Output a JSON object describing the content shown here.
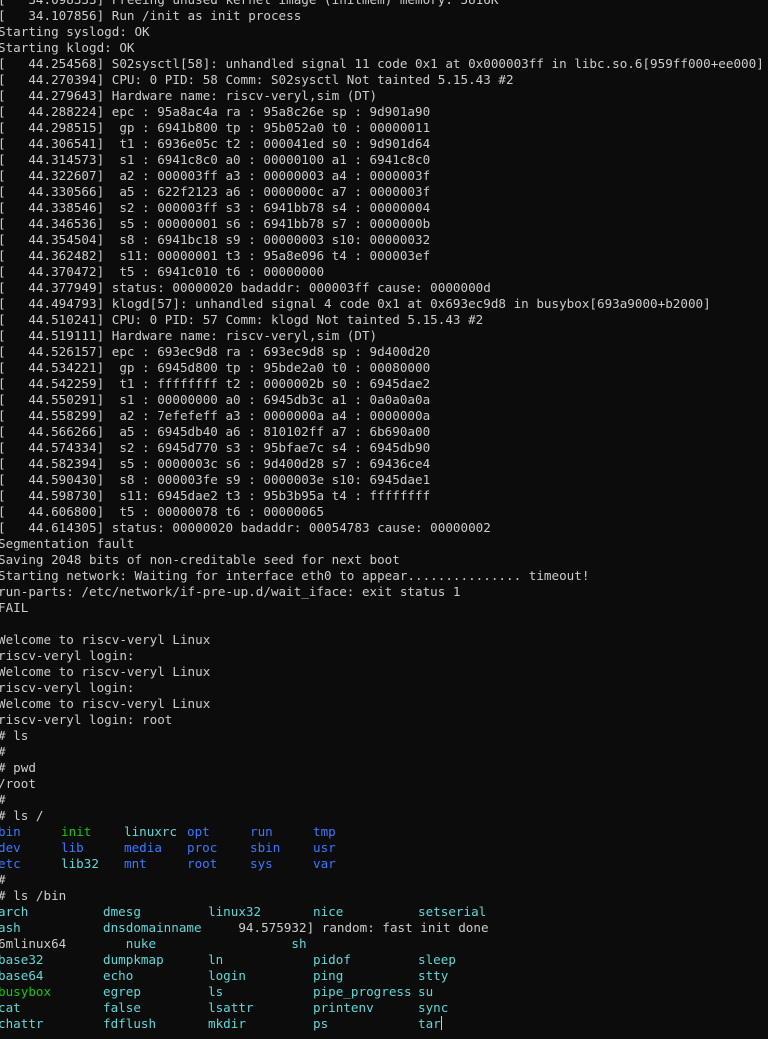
{
  "terminal": {
    "log_lines": [
      "[   34.098333] Freeing unused kernel image (initmem) memory: 5816K",
      "[   34.107856] Run /init as init process",
      "Starting syslogd: OK",
      "Starting klogd: OK",
      "[   44.254568] S02sysctl[58]: unhandled signal 11 code 0x1 at 0x000003ff in libc.so.6[959ff000+ee000]",
      "[   44.270394] CPU: 0 PID: 58 Comm: S02sysctl Not tainted 5.15.43 #2",
      "[   44.279643] Hardware name: riscv-veryl,sim (DT)",
      "[   44.288224] epc : 95a8ac4a ra : 95a8c26e sp : 9d901a90",
      "[   44.298515]  gp : 6941b800 tp : 95b052a0 t0 : 00000011",
      "[   44.306541]  t1 : 6936e05c t2 : 000041ed s0 : 9d901d64",
      "[   44.314573]  s1 : 6941c8c0 a0 : 00000100 a1 : 6941c8c0",
      "[   44.322607]  a2 : 000003ff a3 : 00000003 a4 : 0000003f",
      "[   44.330566]  a5 : 622f2123 a6 : 0000000c a7 : 0000003f",
      "[   44.338546]  s2 : 000003ff s3 : 6941bb78 s4 : 00000004",
      "[   44.346536]  s5 : 00000001 s6 : 6941bb78 s7 : 0000000b",
      "[   44.354504]  s8 : 6941bc18 s9 : 00000003 s10: 00000032",
      "[   44.362482]  s11: 00000001 t3 : 95a8e096 t4 : 000003ef",
      "[   44.370472]  t5 : 6941c010 t6 : 00000000",
      "[   44.377949] status: 00000020 badaddr: 000003ff cause: 0000000d",
      "[   44.494793] klogd[57]: unhandled signal 4 code 0x1 at 0x693ec9d8 in busybox[693a9000+b2000]",
      "[   44.510241] CPU: 0 PID: 57 Comm: klogd Not tainted 5.15.43 #2",
      "[   44.519111] Hardware name: riscv-veryl,sim (DT)",
      "[   44.526157] epc : 693ec9d8 ra : 693ec9d8 sp : 9d400d20",
      "[   44.534221]  gp : 6945d800 tp : 95bde2a0 t0 : 00080000",
      "[   44.542259]  t1 : ffffffff t2 : 0000002b s0 : 6945dae2",
      "[   44.550291]  s1 : 00000000 a0 : 6945db3c a1 : 0a0a0a0a",
      "[   44.558299]  a2 : 7efefeff a3 : 0000000a a4 : 0000000a",
      "[   44.566266]  a5 : 6945db40 a6 : 810102ff a7 : 6b690a00",
      "[   44.574334]  s2 : 6945d770 s3 : 95bfae7c s4 : 6945db90",
      "[   44.582394]  s5 : 0000003c s6 : 9d400d28 s7 : 69436ce4",
      "[   44.590430]  s8 : 000003fe s9 : 0000003e s10: 6945dae1",
      "[   44.598730]  s11: 6945dae2 t3 : 95b3b95a t4 : ffffffff",
      "[   44.606800]  t5 : 00000078 t6 : 00000065",
      "[   44.614305] status: 00000020 badaddr: 00054783 cause: 00000002",
      "Segmentation fault",
      "Saving 2048 bits of non-creditable seed for next boot",
      "Starting network: Waiting for interface eth0 to appear............... timeout!",
      "run-parts: /etc/network/if-pre-up.d/wait_iface: exit status 1",
      "FAIL",
      "",
      "Welcome to riscv-veryl Linux",
      "riscv-veryl login:",
      "Welcome to riscv-veryl Linux",
      "riscv-veryl login:",
      "Welcome to riscv-veryl Linux",
      "riscv-veryl login: root",
      "# ls",
      "#",
      "# pwd",
      "/root",
      "#",
      "# ls /"
    ],
    "ls_root_rows": [
      [
        {
          "text": "bin",
          "color": "blue"
        },
        {
          "text": "init",
          "color": "green"
        },
        {
          "text": "linuxrc",
          "color": "cyan"
        },
        {
          "text": "opt",
          "color": "blue"
        },
        {
          "text": "run",
          "color": "blue"
        },
        {
          "text": "tmp",
          "color": "blue"
        }
      ],
      [
        {
          "text": "dev",
          "color": "blue"
        },
        {
          "text": "lib",
          "color": "blue"
        },
        {
          "text": "media",
          "color": "blue"
        },
        {
          "text": "proc",
          "color": "blue"
        },
        {
          "text": "sbin",
          "color": "blue"
        },
        {
          "text": "usr",
          "color": "blue"
        }
      ],
      [
        {
          "text": "etc",
          "color": "blue"
        },
        {
          "text": "lib32",
          "color": "cyan"
        },
        {
          "text": "mnt",
          "color": "blue"
        },
        {
          "text": "root",
          "color": "blue"
        },
        {
          "text": "sys",
          "color": "blue"
        },
        {
          "text": "var",
          "color": "blue"
        }
      ]
    ],
    "after_ls_root": [
      "#",
      "# ls /bin"
    ],
    "ls_bin_rows": [
      [
        {
          "text": "arch",
          "color": "cyan"
        },
        {
          "text": "dmesg",
          "color": "cyan"
        },
        {
          "text": "linux32",
          "color": "cyan"
        },
        {
          "text": "nice",
          "color": "cyan"
        },
        {
          "text": "setserial",
          "color": "cyan"
        }
      ],
      [
        {
          "text": "ash",
          "color": "cyan"
        },
        {
          "text": "dnsdomainname",
          "color": "cyan"
        },
        {
          "text": "    94.575932] random: fast init done",
          "color": "default"
        }
      ],
      [
        {
          "text": "6mlinux64",
          "color": "default"
        },
        {
          "text": "   nuke",
          "color": "cyan"
        },
        {
          "text": "           sh",
          "color": "cyan"
        }
      ],
      [
        {
          "text": "base32",
          "color": "cyan"
        },
        {
          "text": "dumpkmap",
          "color": "cyan"
        },
        {
          "text": "ln",
          "color": "cyan"
        },
        {
          "text": "pidof",
          "color": "cyan"
        },
        {
          "text": "sleep",
          "color": "cyan"
        }
      ],
      [
        {
          "text": "base64",
          "color": "cyan"
        },
        {
          "text": "echo",
          "color": "cyan"
        },
        {
          "text": "login",
          "color": "cyan"
        },
        {
          "text": "ping",
          "color": "cyan"
        },
        {
          "text": "stty",
          "color": "cyan"
        }
      ],
      [
        {
          "text": "busybox",
          "color": "green"
        },
        {
          "text": "egrep",
          "color": "cyan"
        },
        {
          "text": "ls",
          "color": "cyan"
        },
        {
          "text": "pipe_progress",
          "color": "cyan"
        },
        {
          "text": "su",
          "color": "cyan"
        }
      ],
      [
        {
          "text": "cat",
          "color": "cyan"
        },
        {
          "text": "false",
          "color": "cyan"
        },
        {
          "text": "lsattr",
          "color": "cyan"
        },
        {
          "text": "printenv",
          "color": "cyan"
        },
        {
          "text": "sync",
          "color": "cyan"
        }
      ],
      [
        {
          "text": "chattr",
          "color": "cyan"
        },
        {
          "text": "fdflush",
          "color": "cyan"
        },
        {
          "text": "mkdir",
          "color": "cyan"
        },
        {
          "text": "ps",
          "color": "cyan"
        },
        {
          "text": "tar",
          "color": "cyan"
        }
      ]
    ]
  },
  "colors": {
    "background": "#0c0c0c",
    "default": "#cccccc",
    "blue": "#3b78ff",
    "green": "#16c60c",
    "cyan": "#61d6d6"
  }
}
